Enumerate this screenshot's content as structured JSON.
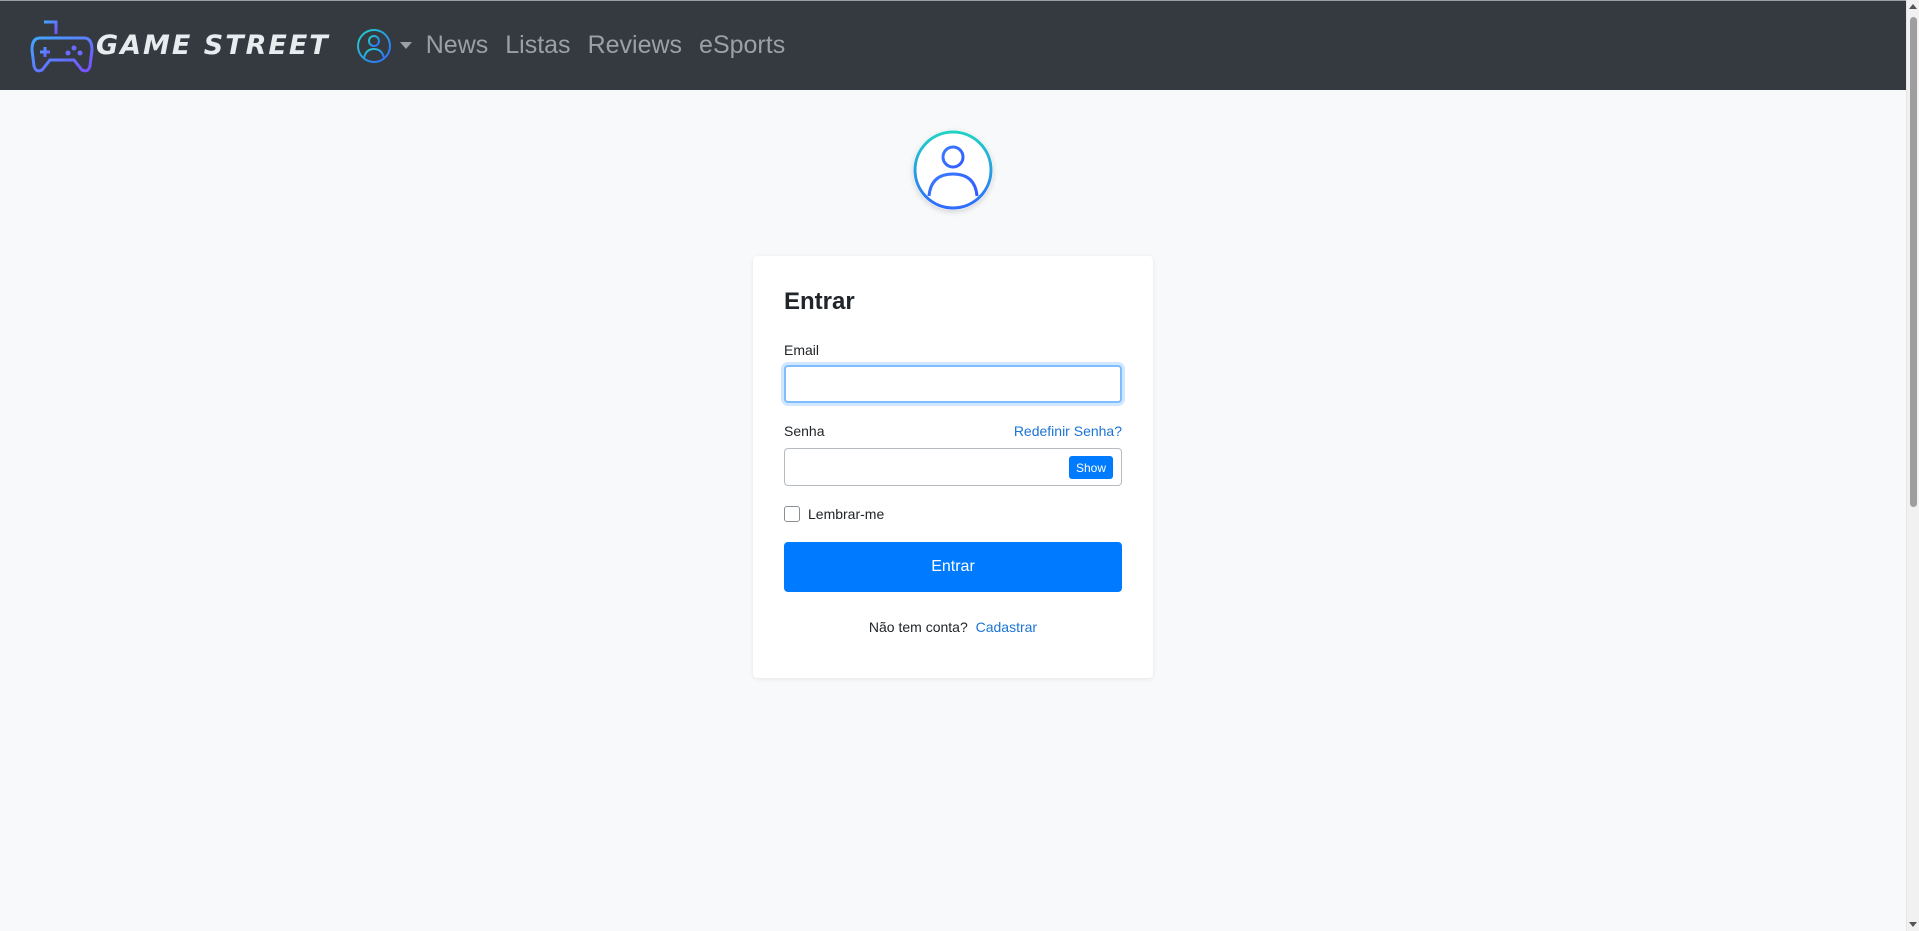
{
  "brand": {
    "name": "GAME STREET",
    "logo_icon": "gamepad-icon"
  },
  "nav": {
    "user_icon": "user-circle-icon",
    "links": [
      "News",
      "Listas",
      "Reviews",
      "eSports"
    ]
  },
  "avatar": {
    "icon": "user-avatar-icon"
  },
  "login": {
    "title": "Entrar",
    "email_label": "Email",
    "email_value": "",
    "password_label": "Senha",
    "forgot_link": "Redefinir Senha?",
    "password_value": "",
    "show_button": "Show",
    "remember_label": "Lembrar-me",
    "remember_checked": false,
    "submit_label": "Entrar",
    "signup_prompt": "Não tem conta?",
    "signup_link": "Cadastrar"
  },
  "colors": {
    "navbar_bg": "#343a40",
    "primary": "#007bff",
    "link": "#1b74d3",
    "page_bg": "#f8f9fa"
  }
}
